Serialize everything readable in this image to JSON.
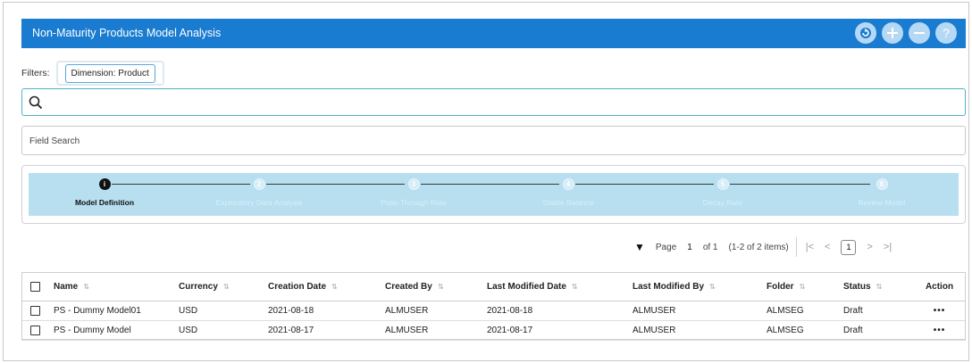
{
  "header": {
    "title": "Non-Maturity Products Model Analysis",
    "icons": [
      "refresh-icon",
      "add-icon",
      "remove-icon",
      "help-icon"
    ]
  },
  "filters": {
    "label": "Filters:",
    "chip": "Dimension: Product"
  },
  "search": {
    "placeholder": ""
  },
  "field_search": {
    "label": "Field Search"
  },
  "stepper": {
    "steps": [
      {
        "label": "Model Definition",
        "index": "",
        "active": true
      },
      {
        "label": "Exploratory Data Analysis",
        "index": "2",
        "active": false
      },
      {
        "label": "Pass-Through Rate",
        "index": "3",
        "active": false
      },
      {
        "label": "Stable Balance",
        "index": "4",
        "active": false
      },
      {
        "label": "Decay Rate",
        "index": "5",
        "active": false
      },
      {
        "label": "Review Model",
        "index": "6",
        "active": false
      }
    ]
  },
  "pagination": {
    "page_label": "Page",
    "page_number": "1",
    "of_label": "of 1",
    "items_label": "(1-2 of 2 items)",
    "current_page": "1",
    "first": "|<",
    "prev": "<",
    "next": ">",
    "last": ">|"
  },
  "table": {
    "columns": [
      "Name",
      "Currency",
      "Creation Date",
      "Created By",
      "Last Modified Date",
      "Last Modified By",
      "Folder",
      "Status",
      "Action"
    ],
    "rows": [
      {
        "name": "PS - Dummy Model01",
        "currency": "USD",
        "creation_date": "2021-08-18",
        "created_by": "ALMUSER",
        "last_modified_date": "2021-08-18",
        "last_modified_by": "ALMUSER",
        "folder": "ALMSEG",
        "status": "Draft",
        "action": "•••"
      },
      {
        "name": "PS - Dummy Model",
        "currency": "USD",
        "creation_date": "2021-08-17",
        "created_by": "ALMUSER",
        "last_modified_date": "2021-08-17",
        "last_modified_by": "ALMUSER",
        "folder": "ALMSEG",
        "status": "Draft",
        "action": "•••"
      }
    ]
  },
  "colors": {
    "header_bg": "#1a7cd0",
    "stepper_bg": "#b7dff0",
    "search_border": "#4fb3c7"
  }
}
